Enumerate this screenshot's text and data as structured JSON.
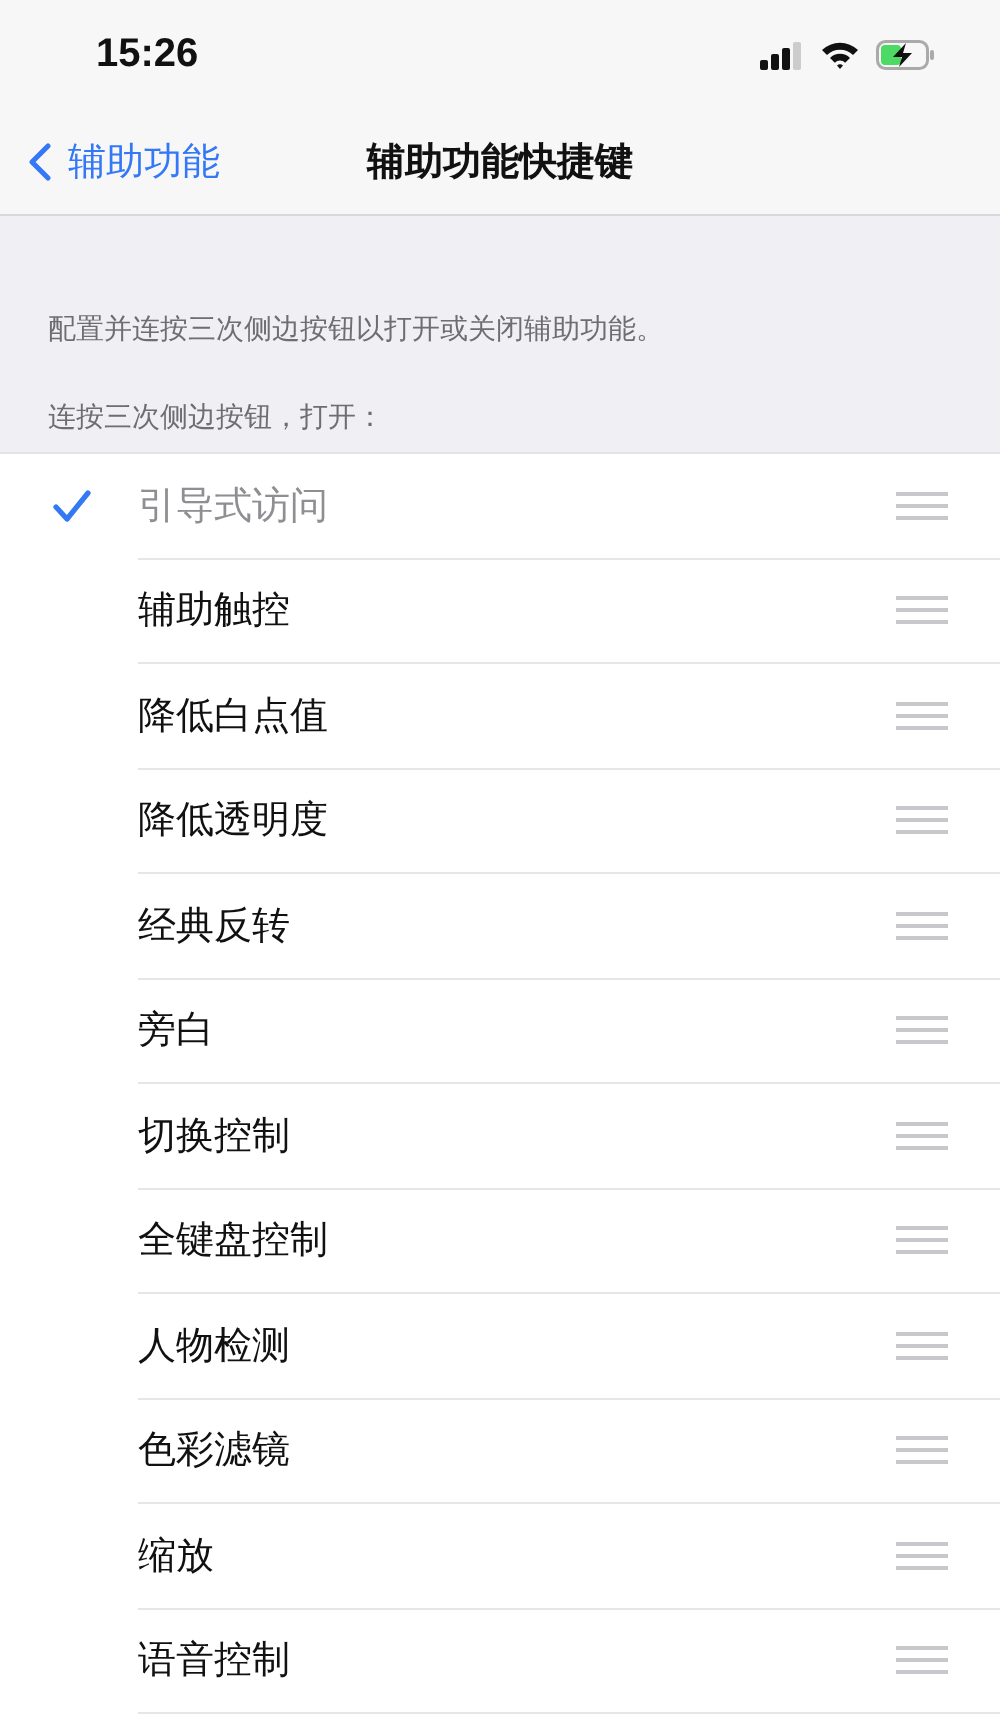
{
  "status_bar": {
    "time": "15:26"
  },
  "nav": {
    "back": "辅助功能",
    "title": "辅助功能快捷键"
  },
  "description": "配置并连按三次侧边按钮以打开或关闭辅助功能。",
  "section_header": "连按三次侧边按钮，打开：",
  "items": [
    {
      "label": "引导式访问",
      "checked": true,
      "disabled": true
    },
    {
      "label": "辅助触控",
      "checked": false,
      "disabled": false
    },
    {
      "label": "降低白点值",
      "checked": false,
      "disabled": false
    },
    {
      "label": "降低透明度",
      "checked": false,
      "disabled": false
    },
    {
      "label": "经典反转",
      "checked": false,
      "disabled": false
    },
    {
      "label": "旁白",
      "checked": false,
      "disabled": false
    },
    {
      "label": "切换控制",
      "checked": false,
      "disabled": false
    },
    {
      "label": "全键盘控制",
      "checked": false,
      "disabled": false
    },
    {
      "label": "人物检测",
      "checked": false,
      "disabled": false
    },
    {
      "label": "色彩滤镜",
      "checked": false,
      "disabled": false
    },
    {
      "label": "缩放",
      "checked": false,
      "disabled": false
    },
    {
      "label": "语音控制",
      "checked": false,
      "disabled": false
    }
  ]
}
